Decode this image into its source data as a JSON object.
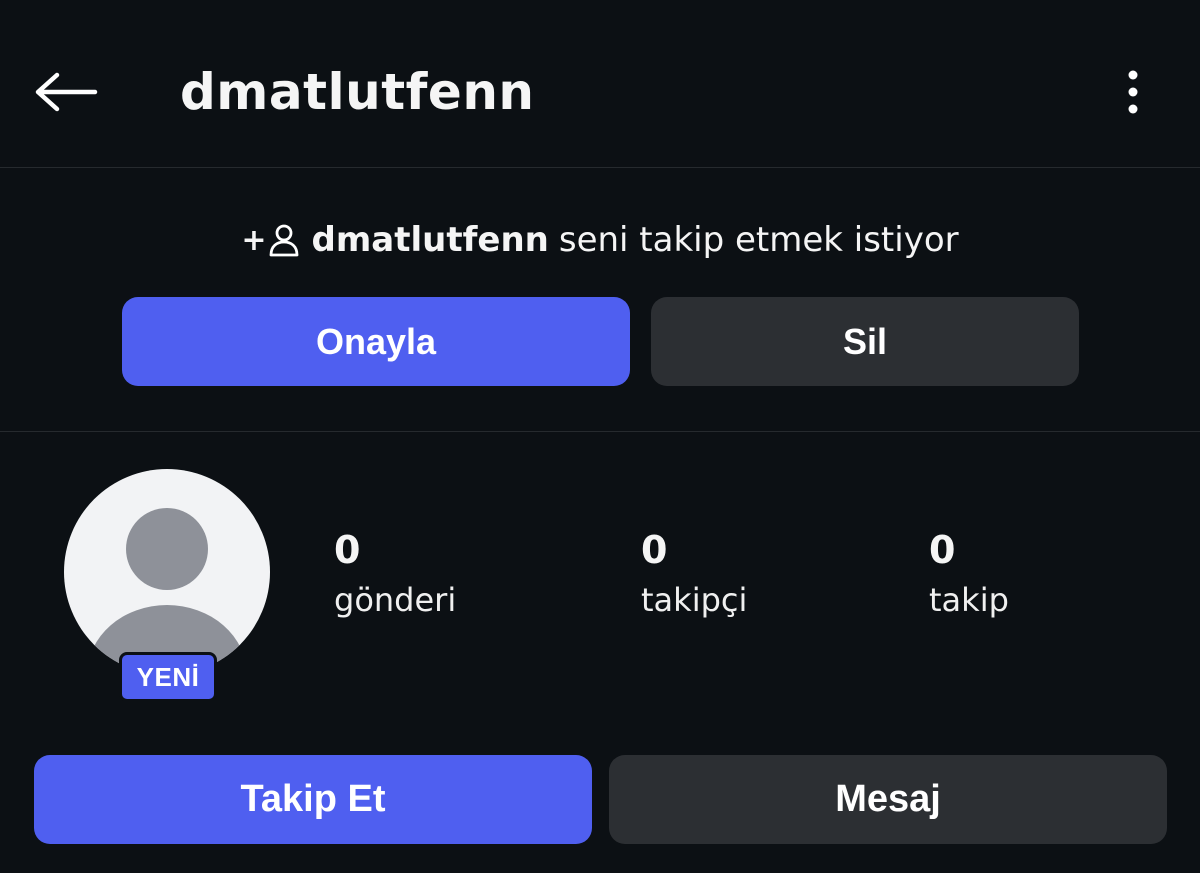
{
  "header": {
    "title": "dmatlutfenn",
    "back_icon": "arrow-left-icon",
    "more_icon": "more-vertical-icon"
  },
  "follow_request": {
    "icon": "add-person-icon",
    "icon_plus": "+",
    "username": "dmatlutfenn",
    "message": "seni takip etmek istiyor",
    "approve_label": "Onayla",
    "delete_label": "Sil"
  },
  "profile": {
    "badge": "YENİ",
    "stats": {
      "posts": {
        "count": "0",
        "label": "gönderi"
      },
      "followers": {
        "count": "0",
        "label": "takipçi"
      },
      "following": {
        "count": "0",
        "label": "takip"
      }
    },
    "follow_label": "Takip Et",
    "message_label": "Mesaj"
  },
  "colors": {
    "background": "#0c1014",
    "primary": "#4f5ff0",
    "secondary": "#2c2f33",
    "divider": "#262a2e",
    "avatar_bg": "#f2f3f5",
    "avatar_silhouette": "#8e9199"
  }
}
